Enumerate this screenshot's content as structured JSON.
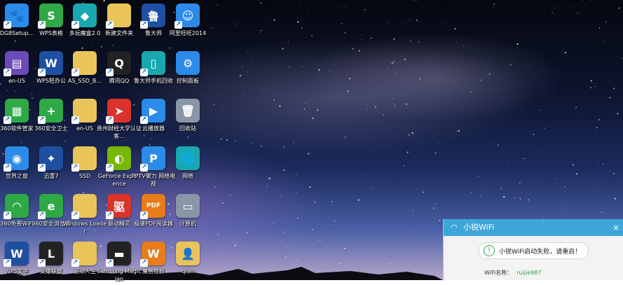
{
  "desktop": {
    "icons": [
      {
        "label": "DG8Setup...",
        "icon": "baidu-paw-icon",
        "glyph": "🐾"
      },
      {
        "label": "WPS表格",
        "icon": "wps-spreadsheet-icon",
        "glyph": "S"
      },
      {
        "label": "多玩魔盒2.0",
        "icon": "duowan-box-icon",
        "glyph": "◆"
      },
      {
        "label": "新建文件夹",
        "icon": "folder-icon",
        "glyph": ""
      },
      {
        "label": "鲁大师",
        "icon": "ludashi-icon",
        "glyph": "鲁"
      },
      {
        "label": "阿里旺旺2014",
        "icon": "aliwangwang-icon",
        "glyph": "☺"
      },
      {
        "label": "en-US",
        "icon": "winrar-icon",
        "glyph": "▤"
      },
      {
        "label": "WPS轻办公",
        "icon": "wps-light-office-icon",
        "glyph": "W"
      },
      {
        "label": "AS_SSD_B...",
        "icon": "folder-icon",
        "glyph": ""
      },
      {
        "label": "腾讯QQ",
        "icon": "qq-penguin-icon",
        "glyph": "Q"
      },
      {
        "label": "鲁大师手机回收",
        "icon": "phone-recycle-icon",
        "glyph": "▯"
      },
      {
        "label": "控制面板",
        "icon": "control-panel-icon",
        "glyph": "⚙"
      },
      {
        "label": "360软件管家",
        "icon": "360-software-manager-icon",
        "glyph": "▦"
      },
      {
        "label": "360安全卫士",
        "icon": "360-security-icon",
        "glyph": "+"
      },
      {
        "label": "en-US",
        "icon": "folder-icon",
        "glyph": ""
      },
      {
        "label": "贵州财经大学认证客...",
        "icon": "university-auth-icon",
        "glyph": "➤"
      },
      {
        "label": "云播放器",
        "icon": "cloud-player-icon",
        "glyph": "▶"
      },
      {
        "label": "回收站",
        "icon": "recycle-bin-icon",
        "glyph": "🗑"
      },
      {
        "label": "世界之窗",
        "icon": "theworld-browser-icon",
        "glyph": "◉"
      },
      {
        "label": "迅雷7",
        "icon": "thunder-icon",
        "glyph": "✦"
      },
      {
        "label": "SSD",
        "icon": "folder-icon",
        "glyph": ""
      },
      {
        "label": "GeForce Experience",
        "icon": "geforce-icon",
        "glyph": "◐"
      },
      {
        "label": "PPTV聚力 网络电视",
        "icon": "pptv-icon",
        "glyph": "P"
      },
      {
        "label": "网络",
        "icon": "network-globe-icon",
        "glyph": "🌐"
      },
      {
        "label": "360免费WiFi",
        "icon": "360-wifi-icon",
        "glyph": "◠"
      },
      {
        "label": "360安全浏览器",
        "icon": "360-browser-icon",
        "glyph": "e"
      },
      {
        "label": "Windows Loader",
        "icon": "folder-icon",
        "glyph": ""
      },
      {
        "label": "驱动精灵",
        "icon": "driver-genius-icon",
        "glyph": "驱"
      },
      {
        "label": "极速PDF阅读器",
        "icon": "pdf-reader-icon",
        "glyph": "PDF"
      },
      {
        "label": "计算机",
        "icon": "computer-icon",
        "glyph": "▭"
      },
      {
        "label": "WPS文字",
        "icon": "wps-writer-icon",
        "glyph": "W"
      },
      {
        "label": "英雄联盟",
        "icon": "league-of-legends-icon",
        "glyph": "L"
      },
      {
        "label": "驱动人生",
        "icon": "folder-icon",
        "glyph": ""
      },
      {
        "label": "Samsung Magician",
        "icon": "samsung-magician-icon",
        "glyph": "▬"
      },
      {
        "label": "魔兽世界",
        "icon": "warcraft-icon",
        "glyph": "W"
      },
      {
        "label": "qian",
        "icon": "user-folder-icon",
        "glyph": "👤"
      }
    ]
  },
  "popup": {
    "title": "小锐WiFi",
    "close_glyph": "×",
    "wifi_glyph": "◠",
    "message": "小锐WiFi启动失败，请重启！",
    "ok_glyph": "!",
    "name_label": "WiFi名称：",
    "name_value": "ruijie987"
  }
}
